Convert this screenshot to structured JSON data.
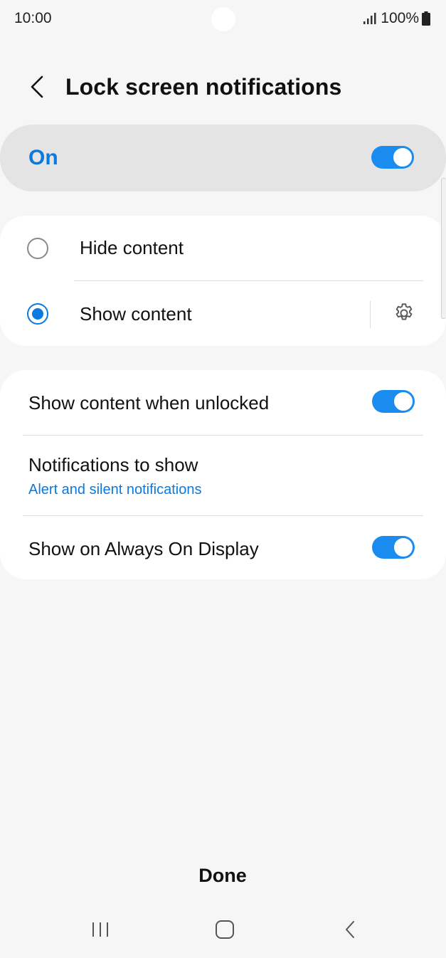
{
  "status_bar": {
    "time": "10:00",
    "battery": "100%",
    "signal_icon": "signal-icon",
    "battery_icon": "battery-icon"
  },
  "header": {
    "back_icon": "chevron-left-icon",
    "title": "Lock screen notifications"
  },
  "master": {
    "label": "On",
    "enabled": true
  },
  "content_options": {
    "items": [
      {
        "label": "Hide content",
        "selected": false
      },
      {
        "label": "Show content",
        "selected": true,
        "settings_icon": "gear-icon"
      }
    ]
  },
  "settings": {
    "show_when_unlocked": {
      "label": "Show content when unlocked",
      "enabled": true
    },
    "notifications_to_show": {
      "label": "Notifications to show",
      "value": "Alert and silent notifications"
    },
    "always_on_display": {
      "label": "Show on Always On Display",
      "enabled": true
    }
  },
  "done_label": "Done",
  "nav": {
    "recents_icon": "recents-icon",
    "home_icon": "home-icon",
    "back_icon": "back-icon"
  },
  "colors": {
    "accent": "#0a7ae0",
    "toggle": "#1a8cf0",
    "background": "#f6f6f6",
    "card": "#ffffff"
  }
}
